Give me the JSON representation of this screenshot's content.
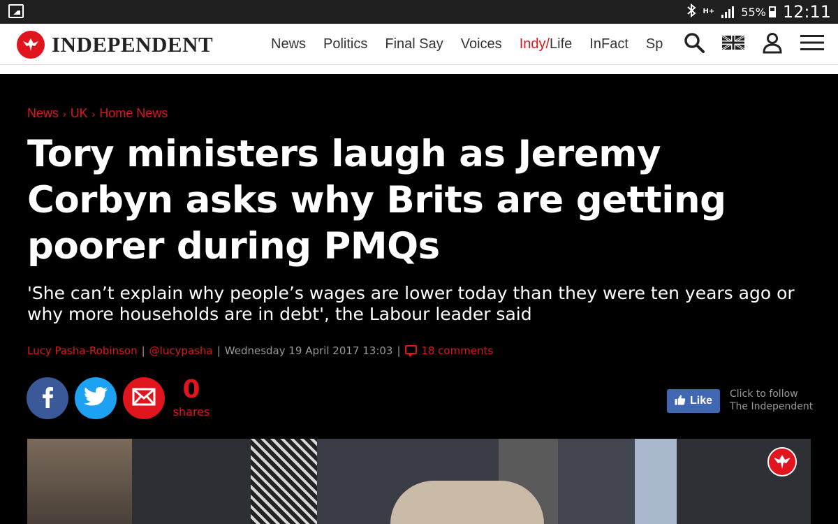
{
  "status_bar": {
    "network": "H+",
    "battery": "55%",
    "time": "12:11"
  },
  "header": {
    "logo_text": "INDEPENDENT",
    "nav": [
      {
        "label": "News"
      },
      {
        "label": "Politics"
      },
      {
        "label": "Final Say"
      },
      {
        "label": "Voices"
      },
      {
        "label_red": "Indy/",
        "label_rest": "Life"
      },
      {
        "label": "InFact"
      },
      {
        "label": "Sp"
      }
    ],
    "icons": [
      "search-icon",
      "uk-flag-icon",
      "user-icon",
      "menu-icon"
    ]
  },
  "article": {
    "breadcrumb": [
      "News",
      "UK",
      "Home News"
    ],
    "headline": "Tory ministers laugh as Jeremy Corbyn asks why Brits are getting poorer during PMQs",
    "standfirst": "'She can’t explain why people’s wages are lower today than they were ten years ago or why more households are in debt', the Labour leader said",
    "byline": {
      "author": "Lucy Pasha-Robinson",
      "handle": "@lucypasha",
      "date": "Wednesday 19 April 2017 13:03",
      "comments": "18 comments"
    }
  },
  "share": {
    "count": "0",
    "count_label": "shares",
    "buttons": [
      "facebook-icon",
      "twitter-icon",
      "email-icon"
    ]
  },
  "follow": {
    "like_label": "Like",
    "line1": "Click to follow",
    "line2": "The Independent"
  },
  "colors": {
    "brand_red": "#e0151e",
    "background": "#000000",
    "facebook": "#3b5998",
    "twitter": "#1da1f2",
    "like_button": "#4267b2"
  }
}
